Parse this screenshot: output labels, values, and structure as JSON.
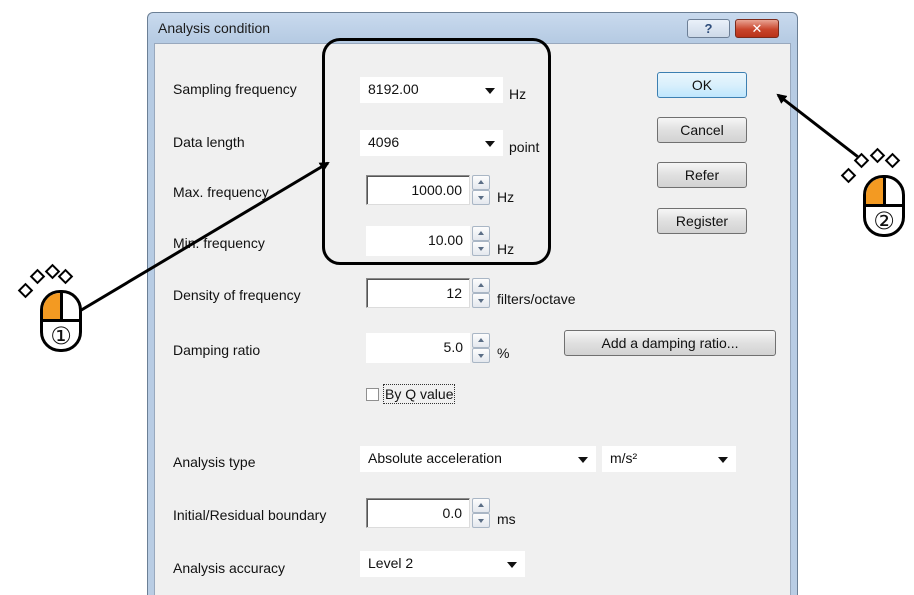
{
  "dialog": {
    "title": "Analysis condition",
    "help_button": "?",
    "close_button": "✕"
  },
  "fields": {
    "sampling_frequency": {
      "label": "Sampling frequency",
      "value": "8192.00",
      "unit": "Hz"
    },
    "data_length": {
      "label": "Data length",
      "value": "4096",
      "unit": "point"
    },
    "max_frequency": {
      "label": "Max. frequency",
      "value": "1000.00",
      "unit": "Hz"
    },
    "min_frequency": {
      "label": "Min. frequency",
      "value": "10.00",
      "unit": "Hz"
    },
    "density_of_frequency": {
      "label": "Density of frequency",
      "value": "12",
      "unit": "filters/octave"
    },
    "damping_ratio": {
      "label": "Damping ratio",
      "value": "5.0",
      "unit": "%"
    },
    "by_q_value": {
      "label": "By Q value",
      "checked": false
    },
    "analysis_type": {
      "label": "Analysis type",
      "value": "Absolute acceleration",
      "unit_value": "m/s²"
    },
    "initial_residual_boundary": {
      "label": "Initial/Residual boundary",
      "value": "0.0",
      "unit": "ms"
    },
    "analysis_accuracy": {
      "label": "Analysis accuracy",
      "value": "Level 2"
    }
  },
  "buttons": {
    "ok": "OK",
    "cancel": "Cancel",
    "refer": "Refer",
    "register": "Register",
    "add_damping_ratio": "Add a damping ratio..."
  },
  "annotations": {
    "mouse_1": "①",
    "mouse_2": "②",
    "highlight_color": "#000000",
    "mouse_button_color": "#f39a22"
  }
}
